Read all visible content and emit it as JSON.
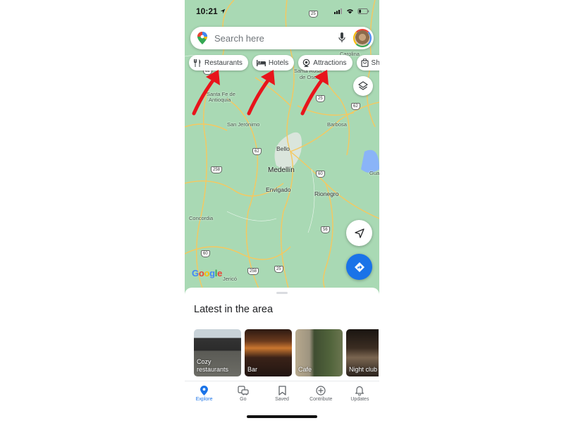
{
  "status_bar": {
    "time": "10:21"
  },
  "search": {
    "placeholder": "Search here"
  },
  "chips": [
    {
      "label": "Restaurants",
      "icon": "fork-knife-icon"
    },
    {
      "label": "Hotels",
      "icon": "bed-icon"
    },
    {
      "label": "Attractions",
      "icon": "attraction-icon"
    },
    {
      "label": "Shopping",
      "icon": "shopping-bag-icon"
    }
  ],
  "map": {
    "places": {
      "carolina": "Carolina",
      "santa_rosa": "Santa Rosa",
      "santa_rosa_2": "de Osos",
      "santa_fe": "Santa Fe de",
      "santa_fe_2": "Antioquia",
      "san_jeronimo": "San Jerónimo",
      "barbosa": "Barbosa",
      "bello": "Bello",
      "medellin": "Medellín",
      "envigado": "Envigado",
      "rionegro": "Rionegro",
      "guatape": "Guat",
      "concordia": "Concordia",
      "jerico": "Jericó"
    },
    "shields": {
      "r25a": "25",
      "r62a": "62",
      "r25b": "25",
      "r62b": "62",
      "r62c": "62",
      "r258a": "258",
      "r60a": "60",
      "r56": "56",
      "r60b": "60",
      "r258b": "258",
      "r25c": "25"
    },
    "attribution": "Google"
  },
  "sheet": {
    "title": "Latest in the area",
    "cards": [
      {
        "label_line1": "Cozy",
        "label_line2": "restaurants"
      },
      {
        "label_line1": "",
        "label_line2": "Bar"
      },
      {
        "label_line1": "",
        "label_line2": "Cafe"
      },
      {
        "label_line1": "",
        "label_line2": "Night club"
      }
    ]
  },
  "tabs": [
    {
      "label": "Explore",
      "active": true
    },
    {
      "label": "Go",
      "active": false
    },
    {
      "label": "Saved",
      "active": false
    },
    {
      "label": "Contribute",
      "active": false
    },
    {
      "label": "Updates",
      "active": false
    }
  ],
  "colors": {
    "accent": "#1a73e8",
    "map_green": "#a8dab5",
    "road": "#f6c85f",
    "annotation_arrow": "#e8141b"
  }
}
